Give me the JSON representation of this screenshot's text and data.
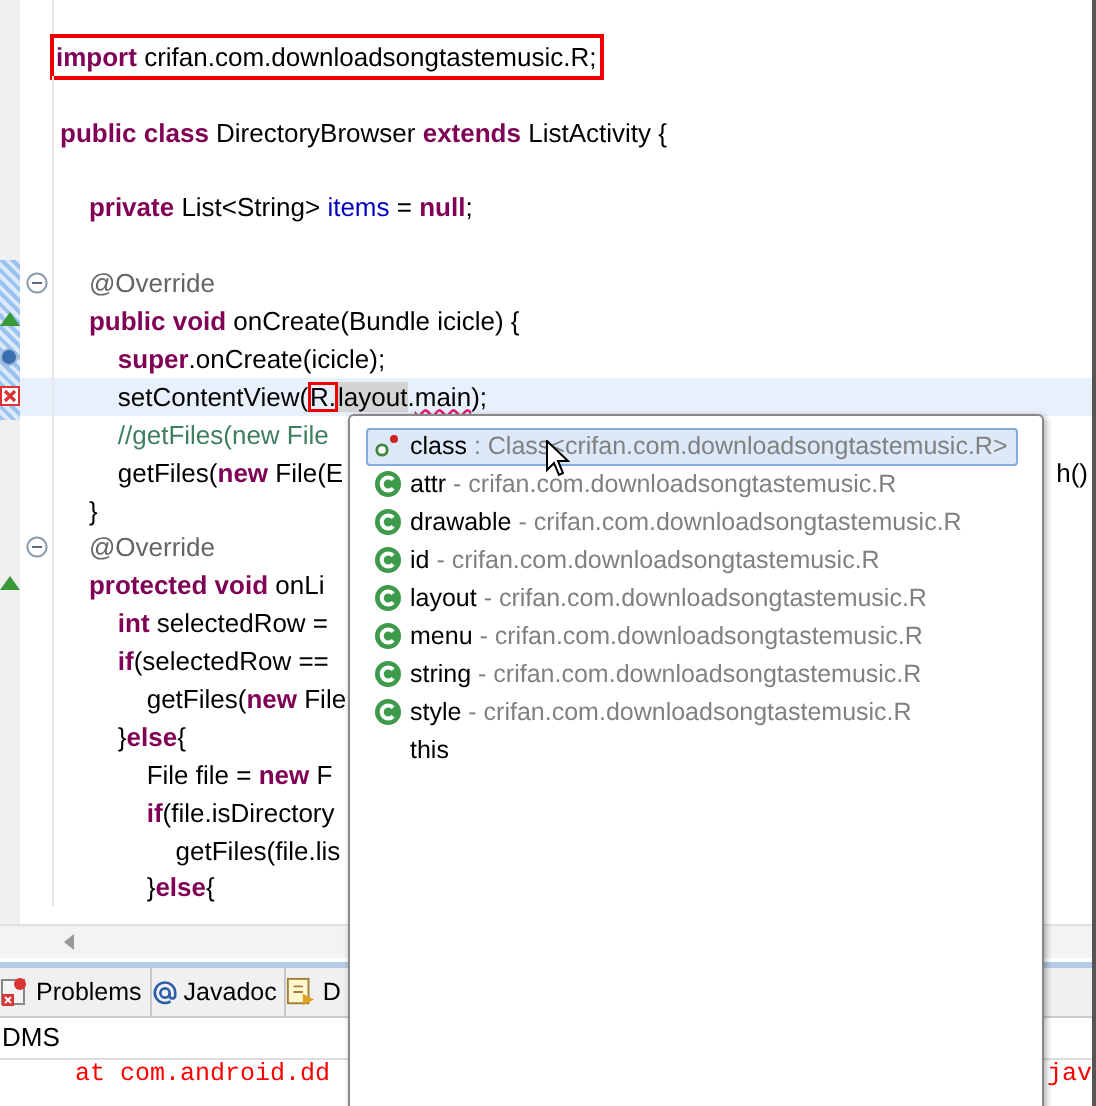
{
  "editor": {
    "lines": [
      {
        "kind": "blank"
      },
      {
        "kind": "plain",
        "boxed": true,
        "current": false,
        "fold": false,
        "tokens": [
          {
            "kind": "kw",
            "text": "import"
          },
          {
            "kind": "plain",
            "text": " crifan.com.downloadsongtastemusic.R;"
          }
        ]
      },
      {
        "kind": "blank"
      },
      {
        "kind": "plain",
        "boxed": false,
        "current": false,
        "fold": false,
        "tokens": [
          {
            "kind": "kw",
            "text": "public class"
          },
          {
            "kind": "plain",
            "text": " DirectoryBrowser "
          },
          {
            "kind": "kw",
            "text": "extends"
          },
          {
            "kind": "plain",
            "text": " ListActivity {"
          }
        ]
      },
      {
        "kind": "blank"
      },
      {
        "kind": "plain",
        "boxed": false,
        "current": false,
        "fold": false,
        "tokens": [
          {
            "kind": "kw",
            "text": "    private"
          },
          {
            "kind": "plain",
            "text": " List<String> "
          },
          {
            "kind": "field",
            "text": "items"
          },
          {
            "kind": "plain",
            "text": " = "
          },
          {
            "kind": "kw",
            "text": "null"
          },
          {
            "kind": "plain",
            "text": ";"
          }
        ]
      },
      {
        "kind": "blank"
      },
      {
        "kind": "plain",
        "boxed": false,
        "current": false,
        "fold": true,
        "tokens": [
          {
            "kind": "annotation",
            "text": "    @Override"
          }
        ]
      },
      {
        "kind": "override",
        "boxed": false,
        "current": false,
        "fold": false,
        "tokens": [
          {
            "kind": "kw",
            "text": "    public void"
          },
          {
            "kind": "plain",
            "text": " onCreate(Bundle icicle) {"
          }
        ]
      },
      {
        "kind": "info",
        "boxed": false,
        "current": false,
        "fold": false,
        "tokens": [
          {
            "kind": "kw",
            "text": "        super"
          },
          {
            "kind": "plain",
            "text": ".onCreate(icicle);"
          }
        ]
      },
      {
        "kind": "error",
        "boxed": false,
        "current": true,
        "fold": false,
        "tokens": [
          {
            "kind": "plain",
            "text": "        setContentView("
          },
          {
            "kind": "caret",
            "text": "R."
          },
          {
            "kind": "occurrence",
            "text": "layout"
          },
          {
            "kind": "plain",
            "text": "."
          },
          {
            "kind": "warning",
            "text": "main"
          },
          {
            "kind": "plain",
            "text": ");"
          }
        ]
      },
      {
        "kind": "plain",
        "boxed": false,
        "current": false,
        "fold": false,
        "tokens": [
          {
            "kind": "comment",
            "text": "        //getFiles(new File"
          }
        ]
      },
      {
        "kind": "plain",
        "boxed": false,
        "current": false,
        "fold": false,
        "tail": "h()",
        "tokens": [
          {
            "kind": "plain",
            "text": "        getFiles("
          },
          {
            "kind": "kw",
            "text": "new"
          },
          {
            "kind": "plain",
            "text": " File(E"
          }
        ]
      },
      {
        "kind": "plain",
        "boxed": false,
        "current": false,
        "fold": false,
        "tokens": [
          {
            "kind": "plain",
            "text": "    }"
          }
        ]
      },
      {
        "kind": "plain",
        "boxed": false,
        "current": false,
        "fold": true,
        "tokens": [
          {
            "kind": "annotation",
            "text": "    @Override"
          }
        ]
      },
      {
        "kind": "override",
        "boxed": false,
        "current": false,
        "fold": false,
        "tokens": [
          {
            "kind": "kw",
            "text": "    protected void"
          },
          {
            "kind": "plain",
            "text": " onLi"
          }
        ]
      },
      {
        "kind": "plain",
        "boxed": false,
        "current": false,
        "fold": false,
        "tokens": [
          {
            "kind": "kw",
            "text": "        int"
          },
          {
            "kind": "plain",
            "text": " selectedRow ="
          }
        ]
      },
      {
        "kind": "plain",
        "boxed": false,
        "current": false,
        "fold": false,
        "tokens": [
          {
            "kind": "kw",
            "text": "        if"
          },
          {
            "kind": "plain",
            "text": "(selectedRow =="
          }
        ]
      },
      {
        "kind": "plain",
        "boxed": false,
        "current": false,
        "fold": false,
        "tokens": [
          {
            "kind": "plain",
            "text": "            getFiles("
          },
          {
            "kind": "kw",
            "text": "new"
          },
          {
            "kind": "plain",
            "text": " File"
          }
        ]
      },
      {
        "kind": "plain",
        "boxed": false,
        "current": false,
        "fold": false,
        "tokens": [
          {
            "kind": "plain",
            "text": "        }"
          },
          {
            "kind": "kw",
            "text": "else"
          },
          {
            "kind": "plain",
            "text": "{"
          }
        ]
      },
      {
        "kind": "plain",
        "boxed": false,
        "current": false,
        "fold": false,
        "tokens": [
          {
            "kind": "plain",
            "text": "            File file = "
          },
          {
            "kind": "kw",
            "text": "new"
          },
          {
            "kind": "plain",
            "text": " F"
          }
        ]
      },
      {
        "kind": "plain",
        "boxed": false,
        "current": false,
        "fold": false,
        "tokens": [
          {
            "kind": "kw",
            "text": "            if"
          },
          {
            "kind": "plain",
            "text": "(file.isDirectory"
          }
        ]
      },
      {
        "kind": "plain",
        "boxed": false,
        "current": false,
        "fold": false,
        "tokens": [
          {
            "kind": "plain",
            "text": "                getFiles(file.lis"
          }
        ]
      },
      {
        "kind": "plain",
        "boxed": false,
        "current": false,
        "fold": false,
        "tokens": [
          {
            "kind": "plain",
            "text": "            }"
          },
          {
            "kind": "kw",
            "text": "else"
          },
          {
            "kind": "plain",
            "text": "{"
          }
        ]
      }
    ]
  },
  "completion_popup": {
    "items": [
      {
        "kind": "static-field",
        "name": "class",
        "detail": " : Class<crifan.com.downloadsongtastemusic.R>",
        "selected": true
      },
      {
        "kind": "class",
        "name": "attr",
        "detail": " - crifan.com.downloadsongtastemusic.R",
        "selected": false
      },
      {
        "kind": "class",
        "name": "drawable",
        "detail": " - crifan.com.downloadsongtastemusic.R",
        "selected": false
      },
      {
        "kind": "class",
        "name": "id",
        "detail": " - crifan.com.downloadsongtastemusic.R",
        "selected": false
      },
      {
        "kind": "class",
        "name": "layout",
        "detail": " - crifan.com.downloadsongtastemusic.R",
        "selected": false
      },
      {
        "kind": "class",
        "name": "menu",
        "detail": " - crifan.com.downloadsongtastemusic.R",
        "selected": false
      },
      {
        "kind": "class",
        "name": "string",
        "detail": " - crifan.com.downloadsongtastemusic.R",
        "selected": false
      },
      {
        "kind": "class",
        "name": "style",
        "detail": " - crifan.com.downloadsongtastemusic.R",
        "selected": false
      },
      {
        "kind": "keyword",
        "name": "this",
        "selected": false
      }
    ]
  },
  "bottom_tabs": [
    {
      "kind": "problems",
      "label": "Problems"
    },
    {
      "kind": "javadoc",
      "label": "Javadoc"
    },
    {
      "kind": "declaration",
      "label": "D"
    }
  ],
  "console": {
    "title": "DMS",
    "lines": [
      {
        "text": "     at com.android.dd",
        "tail": "jav"
      }
    ]
  }
}
